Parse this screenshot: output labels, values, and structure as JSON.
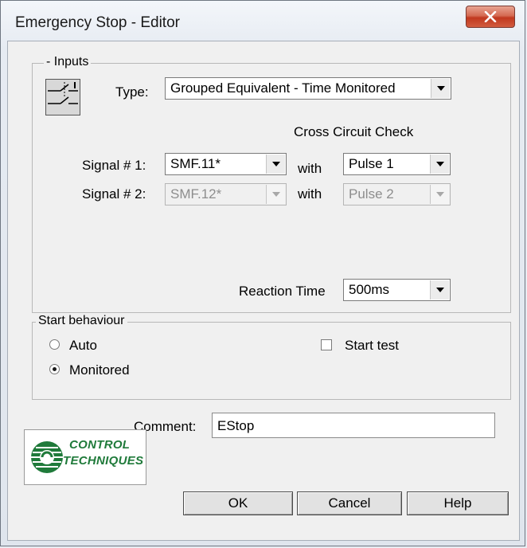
{
  "window": {
    "title": "Emergency Stop - Editor"
  },
  "inputs": {
    "group_label": "- Inputs",
    "type_label": "Type:",
    "type_value": "Grouped Equivalent - Time Monitored",
    "cross_circuit_label": "Cross Circuit Check",
    "signal1": {
      "label": "Signal # 1:",
      "value": "SMF.11*",
      "with_label": "with",
      "pulse_value": "Pulse 1",
      "enabled": true
    },
    "signal2": {
      "label": "Signal # 2:",
      "value": "SMF.12*",
      "with_label": "with",
      "pulse_value": "Pulse 2",
      "enabled": false
    },
    "reaction_time_label": "Reaction Time",
    "reaction_time_value": "500ms"
  },
  "start_behaviour": {
    "group_label": "Start behaviour",
    "options": [
      {
        "label": "Auto",
        "selected": false
      },
      {
        "label": "Monitored",
        "selected": true
      }
    ],
    "start_test": {
      "label": "Start test",
      "checked": false
    }
  },
  "comment": {
    "label": "Comment:",
    "value": "EStop"
  },
  "buttons": {
    "ok": "OK",
    "cancel": "Cancel",
    "help": "Help"
  },
  "logo": {
    "line1": "CONTROL",
    "line2": "TECHNIQUES",
    "color": "#1f7a3a"
  },
  "colors": {
    "close_button": "#c1391f"
  },
  "icons": [
    "close-icon",
    "contact-switch-icon",
    "dropdown-arrow-icon",
    "logo-globe-icon"
  ]
}
